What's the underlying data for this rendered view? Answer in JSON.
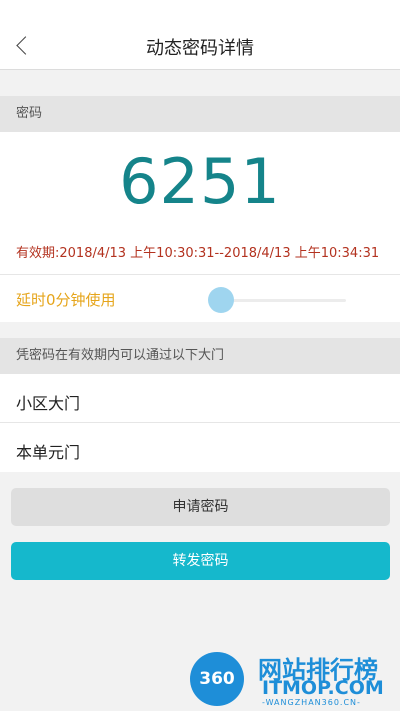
{
  "header": {
    "title": "动态密码详情",
    "back_icon": "chevron-left-icon"
  },
  "password_section": {
    "heading": "密码",
    "code": "6251",
    "validity": "有效期:2018/4/13 上午10:30:31--2018/4/13 上午10:34:31"
  },
  "delay": {
    "label": "延时0分钟使用",
    "value": 0
  },
  "doors_section": {
    "heading": "凭密码在有效期内可以通过以下大门",
    "items": [
      "小区大门",
      "本单元门"
    ]
  },
  "buttons": {
    "apply": "申请密码",
    "forward": "转发密码"
  },
  "watermark": {
    "logo_text": "360",
    "name": "网站排行榜",
    "domain": "ITMOP.COM",
    "subtitle": "-WANGZHAN360.CN-"
  },
  "colors": {
    "code": "#15848a",
    "validity": "#b3321f",
    "delay": "#e6a51b",
    "primary": "#15b8cc"
  }
}
